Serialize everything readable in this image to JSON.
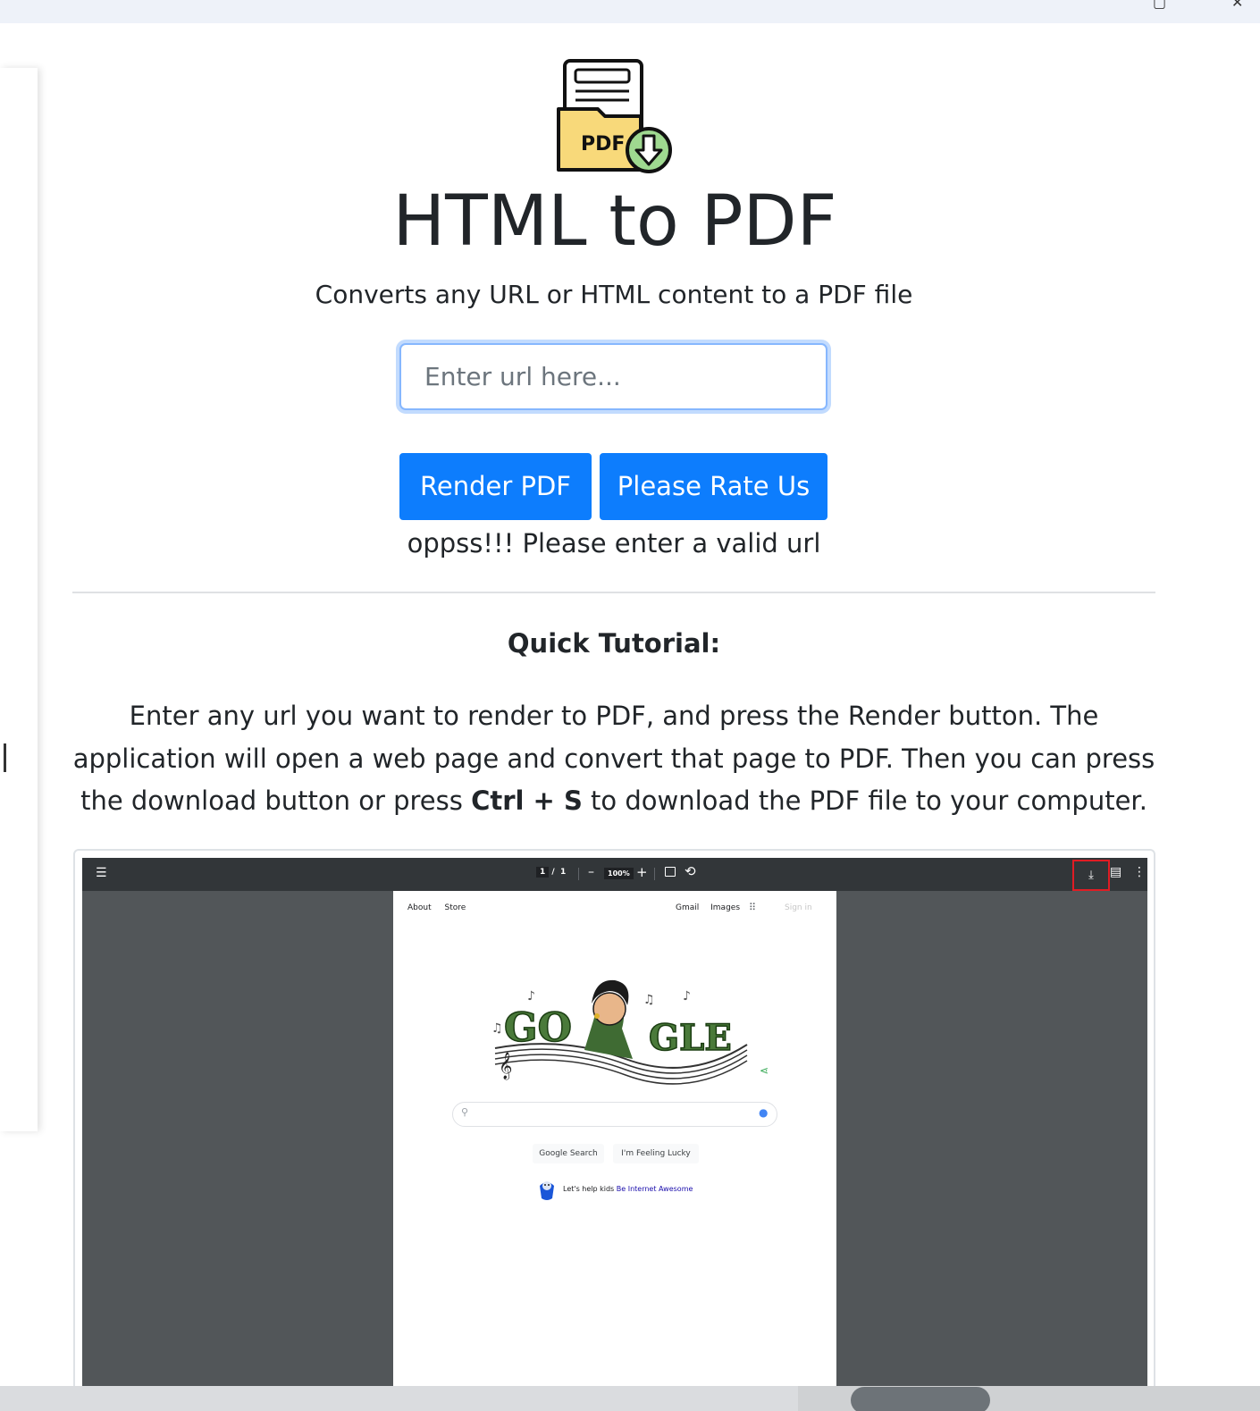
{
  "header": {
    "title": "HTML to PDF",
    "subtitle": "Converts any URL or HTML content to a PDF file"
  },
  "form": {
    "url_placeholder": "Enter url here...",
    "url_value": "",
    "render_button": "Render PDF",
    "rate_button": "Please Rate Us",
    "error_message": "oppss!!! Please enter a valid url"
  },
  "tutorial": {
    "heading": "Quick Tutorial:",
    "text_before": "Enter any url you want to render to PDF, and press the Render button. The application will open a web page and convert that page to PDF. Then you can press the download button or press ",
    "shortcut": "Ctrl + S",
    "text_after": " to download the PDF file to your computer."
  },
  "screenshot": {
    "toolbar": {
      "page_current": "1",
      "page_sep": "/",
      "page_total": "1",
      "zoom": "100%",
      "minus": "–",
      "plus": "+"
    },
    "google": {
      "about": "About",
      "store": "Store",
      "gmail": "Gmail",
      "images": "Images",
      "sign_in": "Sign in",
      "search_button": "Google Search",
      "lucky_button": "I'm Feeling Lucky",
      "promo_text": "Let's help kids ",
      "promo_link": "Be Internet Awesome"
    }
  },
  "icons": {
    "logo": "pdf-download-file-icon",
    "menu": "hamburger-icon",
    "fit": "fit-page-icon",
    "rotate": "rotate-icon",
    "download": "download-icon",
    "print": "print-icon",
    "more": "more-vert-icon"
  },
  "colors": {
    "primary_button": "#0d7dfd",
    "input_focus_border": "#86b7fe",
    "viewer_toolbar": "#323639",
    "viewer_background": "#525659",
    "highlight": "#e01c24"
  }
}
